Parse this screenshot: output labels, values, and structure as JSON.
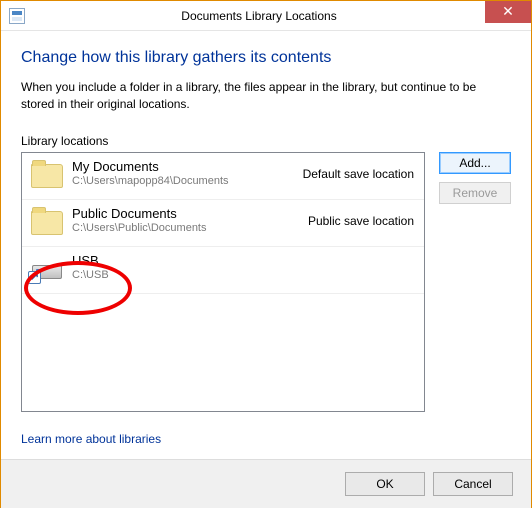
{
  "window": {
    "title": "Documents Library Locations",
    "close_glyph": "✕"
  },
  "heading": "Change how this library gathers its contents",
  "description": "When you include a folder in a library, the files appear in the library, but continue to be stored in their original locations.",
  "list_label": "Library locations",
  "locations": [
    {
      "name": "My Documents",
      "path": "C:\\Users\\mapopp84\\Documents",
      "status": "Default save location",
      "icon": "folder"
    },
    {
      "name": "Public Documents",
      "path": "C:\\Users\\Public\\Documents",
      "status": "Public save location",
      "icon": "folder"
    },
    {
      "name": "USB",
      "path": "C:\\USB",
      "status": "",
      "icon": "drive-shortcut"
    }
  ],
  "buttons": {
    "add": "Add...",
    "remove": "Remove",
    "ok": "OK",
    "cancel": "Cancel"
  },
  "learn_link": "Learn more about libraries"
}
